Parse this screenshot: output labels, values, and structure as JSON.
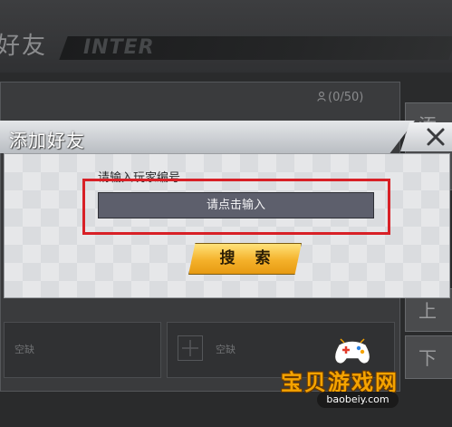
{
  "background": {
    "screen_title": "好友",
    "banner_text": "INTER",
    "friend_count": "(0/50)",
    "side_buttons": [
      "添",
      "中",
      "上",
      "下"
    ],
    "empty_slot_label": "空缺"
  },
  "dialog": {
    "title": "添加好友",
    "input_label": "请输入玩家编号",
    "input_placeholder": "请点击输入",
    "search_button": "搜 索"
  },
  "watermark": {
    "name": "宝贝游戏网",
    "url": "baobeiy.com"
  },
  "colors": {
    "highlight": "#d82026",
    "search_button": "#f4b12a",
    "input_bg": "#5d5f6c"
  }
}
